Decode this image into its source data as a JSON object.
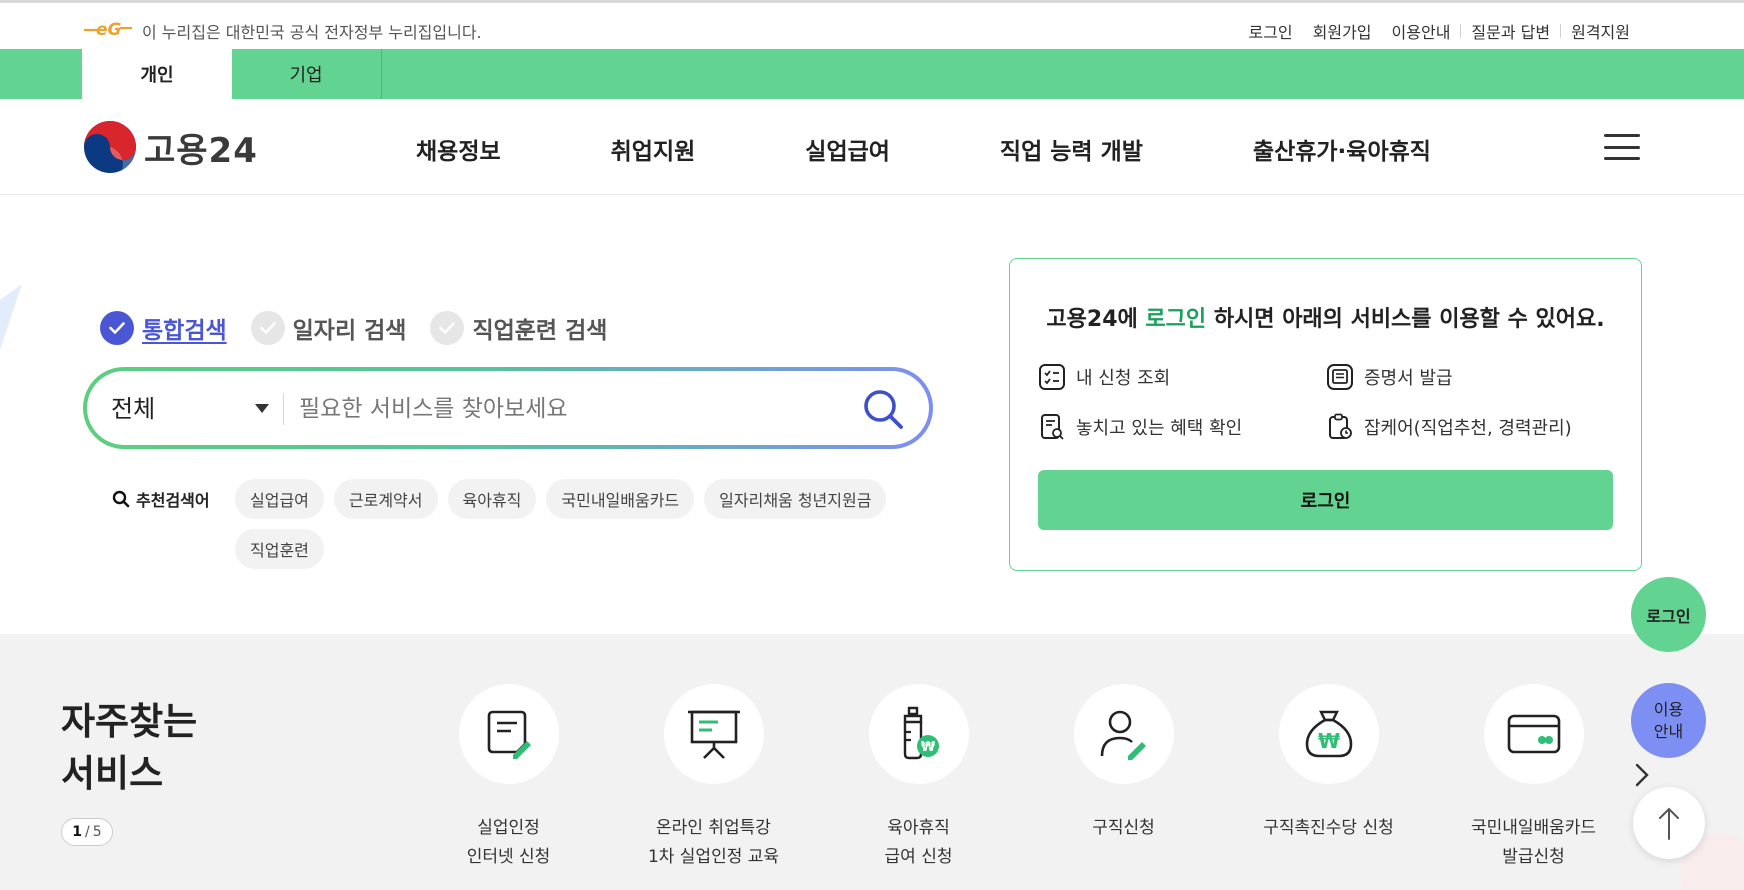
{
  "top_bar": {
    "gov_notice": "이 누리집은 대한민국 공식 전자정부 누리집입니다.",
    "links": [
      "로그인",
      "회원가입",
      "이용안내",
      "질문과 답변",
      "원격지원"
    ]
  },
  "tabs": [
    {
      "label": "개인",
      "active": true
    },
    {
      "label": "기업",
      "active": false
    }
  ],
  "header": {
    "brand": "고용24",
    "nav": [
      "채용정보",
      "취업지원",
      "실업급여",
      "직업 능력 개발",
      "출산휴가·육아휴직"
    ]
  },
  "search": {
    "types": [
      {
        "label": "통합검색",
        "active": true
      },
      {
        "label": "일자리 검색",
        "active": false
      },
      {
        "label": "직업훈련 검색",
        "active": false
      }
    ],
    "scope": "전체",
    "placeholder": "필요한 서비스를 찾아보세요",
    "recommended_label": "추천검색어",
    "recommended": [
      "실업급여",
      "근로계약서",
      "육아휴직",
      "국민내일배움카드",
      "일자리채움 청년지원금",
      "직업훈련"
    ]
  },
  "login_panel": {
    "title_prefix": "고용24에 ",
    "title_accent": "로그인",
    "title_suffix": " 하시면 아래의 서비스를 이용할 수 있어요.",
    "items": [
      "내 신청 조회",
      "증명서 발급",
      "놓치고 있는 혜택 확인",
      "잡케어(직업추천, 경력관리)"
    ],
    "button": "로그인",
    "accent_color": "#1aa05c"
  },
  "floating": {
    "login": "로그인",
    "guide_line1": "이용",
    "guide_line2": "안내"
  },
  "services": {
    "title_line1": "자주찾는",
    "title_line2": "서비스",
    "page_current": "1",
    "page_total": "5",
    "items": [
      {
        "label": "실업인정\n인터넷 신청",
        "icon": "document-edit-icon"
      },
      {
        "label": "온라인 취업특강\n1차 실업인정 교육",
        "icon": "presentation-board-icon"
      },
      {
        "label": "육아휴직\n급여 신청",
        "icon": "baby-bottle-won-icon"
      },
      {
        "label": "구직신청",
        "icon": "person-edit-icon"
      },
      {
        "label": "구직촉진수당 신청",
        "icon": "money-bag-icon"
      },
      {
        "label": "국민내일배움카드\n발급신청",
        "icon": "credit-card-icon"
      }
    ]
  },
  "colors": {
    "brand_green": "#62d391",
    "brand_blue": "#4a56d4",
    "guide_blue": "#7d8ff2"
  }
}
